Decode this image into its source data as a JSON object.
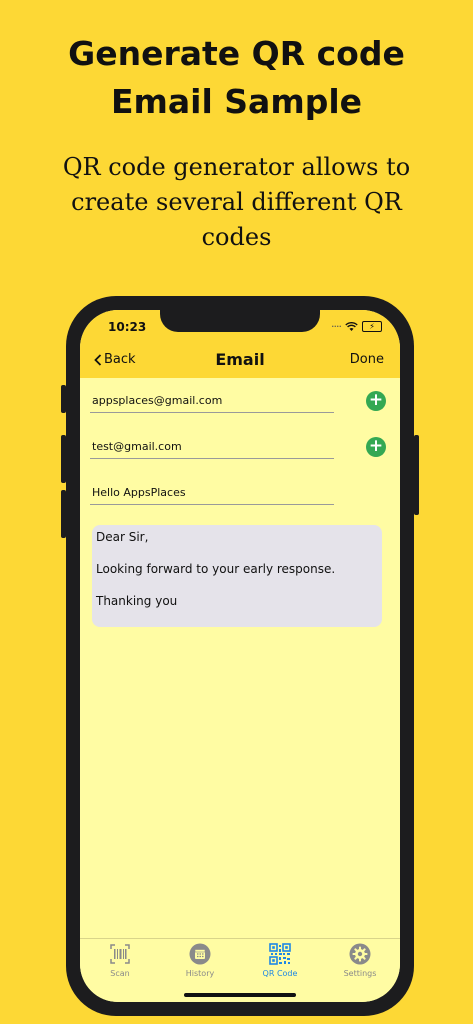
{
  "promo": {
    "headline_line1": "Generate QR code",
    "headline_line2": "Email Sample",
    "subtitle_line1": "QR code generator allows to",
    "subtitle_line2": "create several different QR",
    "subtitle_line3": "codes"
  },
  "status_bar": {
    "time": "10:23",
    "battery_icon": "battery-charging-icon",
    "wifi_icon": "wifi-icon"
  },
  "nav": {
    "back_label": "Back",
    "title": "Email",
    "done_label": "Done"
  },
  "form": {
    "to_value": "appsplaces@gmail.com",
    "cc_value": "test@gmail.com",
    "subject_value": "Hello AppsPlaces",
    "body_line1": "Dear Sir,",
    "body_line2": "Looking forward to your early response.",
    "body_line3": "Thanking you"
  },
  "tabs": [
    {
      "label": "Scan",
      "icon": "barcode-icon",
      "active": false
    },
    {
      "label": "History",
      "icon": "calendar-icon",
      "active": false
    },
    {
      "label": "QR Code",
      "icon": "qr-code-icon",
      "active": true
    },
    {
      "label": "Settings",
      "icon": "gear-icon",
      "active": false
    }
  ],
  "colors": {
    "background": "#fdd835",
    "screen": "#fffca3",
    "accent": "#1e88e5",
    "add_button": "#34a853"
  }
}
